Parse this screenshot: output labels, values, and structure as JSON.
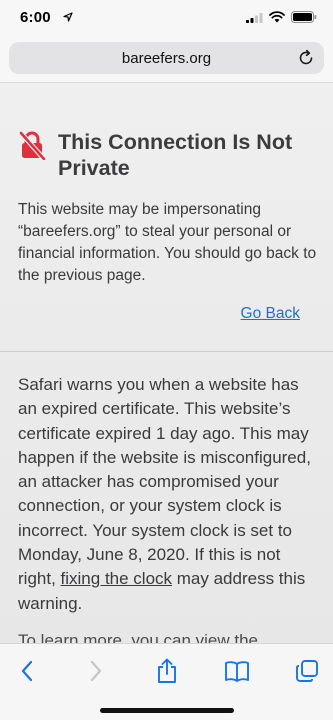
{
  "status_bar": {
    "time": "6:00"
  },
  "url_bar": {
    "domain": "bareefers.org"
  },
  "warning": {
    "title": "This Connection Is Not Private",
    "message": "This website may be impersonating “bareefers.org” to steal your personal or financial information. You should go back to the previous page.",
    "go_back_label": "Go Back",
    "details_before_link": "Safari warns you when a website has an expired certificate. This website’s certificate expired 1 day ago. This may happen if the website is misconfigured, an attacker has compromised your connection, or your system clock is incorrect. Your system clock is set to Monday, June 8, 2020. If this is not right, ",
    "details_link": "fixing the clock",
    "details_after_link": " may address this warning.",
    "partial_next_line": "To learn more, you can view the"
  },
  "colors": {
    "warning_icon": "#e0303f",
    "link": "#1f6fd1",
    "toolbar_icon": "#1a73e8",
    "toolbar_icon_disabled": "#c6c6c8"
  },
  "toolbar": {
    "icons": [
      "back-icon",
      "forward-icon",
      "share-icon",
      "bookmarks-icon",
      "tabs-icon"
    ]
  }
}
